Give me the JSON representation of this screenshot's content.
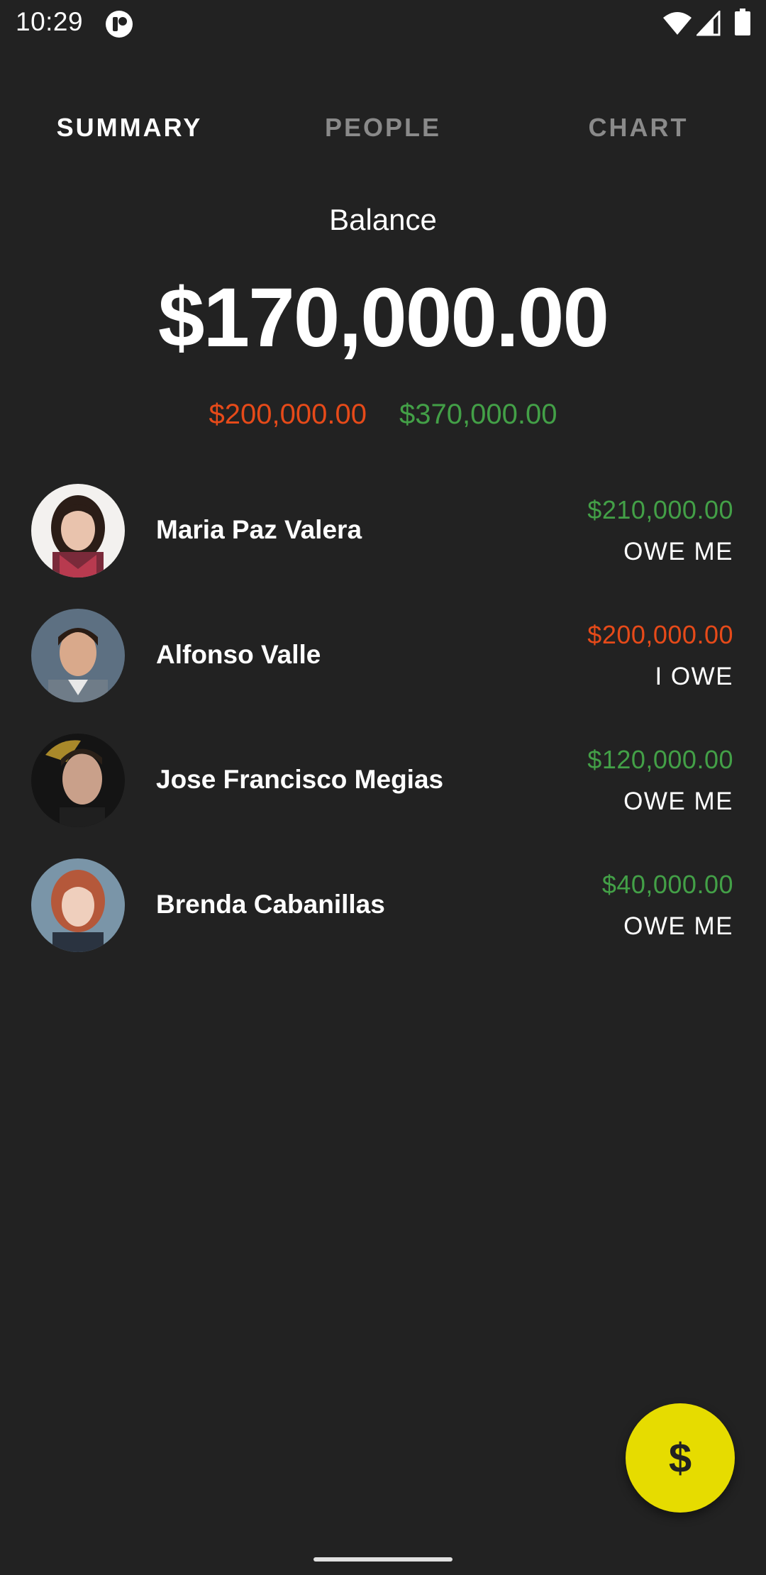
{
  "status_bar": {
    "time": "10:29",
    "icons": [
      "app-notification-icon",
      "wifi-icon",
      "cell-signal-icon",
      "battery-icon"
    ]
  },
  "tabs": [
    {
      "label": "SUMMARY",
      "active": true
    },
    {
      "label": "PEOPLE",
      "active": false
    },
    {
      "label": "CHART",
      "active": false
    }
  ],
  "balance": {
    "label": "Balance",
    "amount": "$170,000.00",
    "debt_total": "$200,000.00",
    "credit_total": "$370,000.00"
  },
  "people": [
    {
      "name": "Maria Paz Valera",
      "amount": "$210,000.00",
      "status": "OWE ME",
      "direction": "credit"
    },
    {
      "name": "Alfonso Valle",
      "amount": "$200,000.00",
      "status": "I OWE",
      "direction": "debt"
    },
    {
      "name": "Jose Francisco Megias",
      "amount": "$120,000.00",
      "status": "OWE ME",
      "direction": "credit"
    },
    {
      "name": "Brenda Cabanillas",
      "amount": "$40,000.00",
      "status": "OWE ME",
      "direction": "credit"
    }
  ],
  "fab": {
    "label": "$",
    "color": "#e6dc00"
  },
  "colors": {
    "background": "#222222",
    "credit": "#43a047",
    "debt": "#e64a19",
    "inactive_tab": "#8a8a8a"
  }
}
